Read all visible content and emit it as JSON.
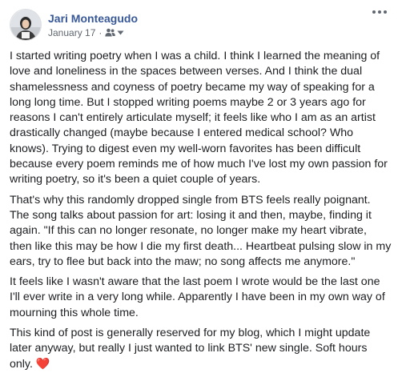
{
  "post": {
    "author_name": "Jari Monteagudo",
    "timestamp": "January 17",
    "separator": "·",
    "audience_icon": "friends-icon",
    "menu_icon": "more-horizontal-icon",
    "paragraphs": [
      "I started writing poetry when I was a child. I think I learned the meaning of love and loneliness in the spaces between verses. And I think the dual shamelessness and coyness of poetry became my way of speaking for a long long time. But I stopped writing poems maybe 2 or 3 years ago for reasons I can't entirely articulate myself; it feels like who I am as an artist drastically changed (maybe because I entered medical school? Who knows). Trying to digest even my well-worn favorites has been difficult because every poem reminds me of how much I've lost my own passion for writing poetry, so it's been a quiet couple of years.",
      "That's why this randomly dropped single from BTS feels really poignant. The song talks about passion for art: losing it and then, maybe, finding it again. \"If this can no longer resonate, no longer make my heart vibrate, then like this may be how I die my first death... Heartbeat pulsing slow in my ears, try to flee but back into the maw; no song affects me anymore.\"",
      "It feels like I wasn't aware that the last poem I wrote would be the last one I'll ever write in a very long while. Apparently I have been in my own way of mourning this whole time.",
      "This kind of post is generally reserved for my blog, which I might update later anyway, but really I just wanted to link BTS' new single. Soft hours only."
    ],
    "closing_emoji": "❤️",
    "colors": {
      "author": "#385898",
      "meta": "#606770",
      "text": "#1c1e21",
      "heart": "#e0245e"
    }
  }
}
